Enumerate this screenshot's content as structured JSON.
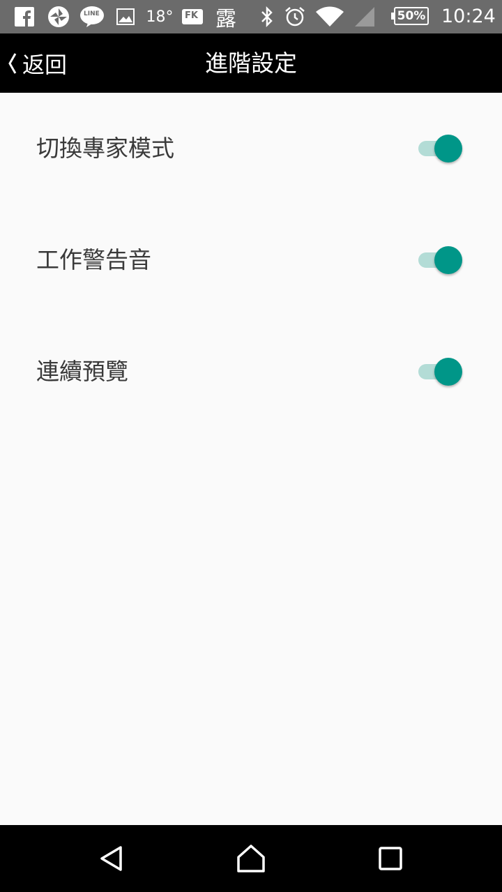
{
  "status_bar": {
    "icons": [
      "facebook-icon",
      "swirl-app-icon",
      "line-app-icon",
      "gallery-icon",
      "weather-temp",
      "fk-app-icon",
      "weather-dew-icon",
      "bluetooth-icon",
      "alarm-icon",
      "wifi-icon",
      "signal-icon"
    ],
    "temperature": "18°",
    "line_label": "LINE",
    "fk_label": "FK",
    "weather_char": "露",
    "battery": "50%",
    "time": "10:24"
  },
  "app_bar": {
    "back_label": "返回",
    "title": "進階設定"
  },
  "settings": [
    {
      "label": "切換專家模式",
      "enabled": true
    },
    {
      "label": "工作警告音",
      "enabled": true
    },
    {
      "label": "連續預覽",
      "enabled": true
    }
  ],
  "nav_bar": {
    "buttons": [
      "back-nav-icon",
      "home-icon",
      "recents-icon"
    ]
  },
  "colors": {
    "accent": "#009688",
    "track": "#b3dcd6",
    "status_bar": "#6b6b6b",
    "app_bar": "#000000",
    "background": "#fafafa"
  }
}
